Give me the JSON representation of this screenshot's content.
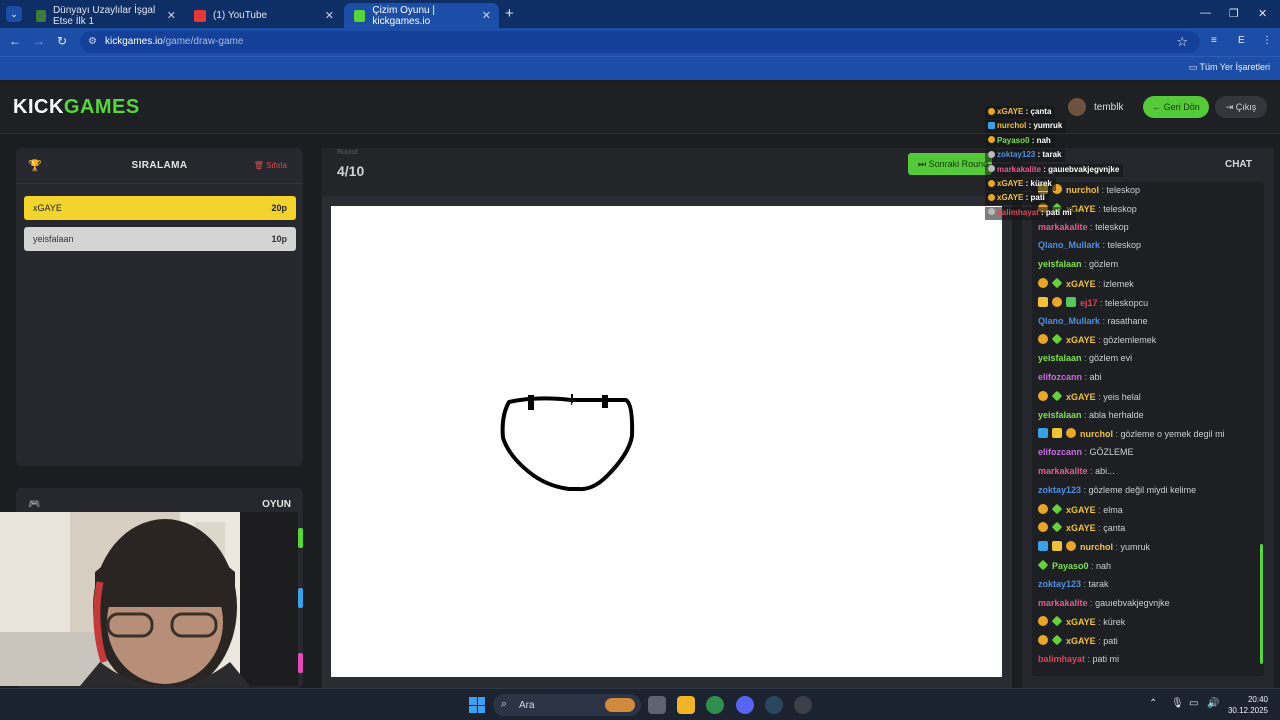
{
  "browser": {
    "tabs": [
      {
        "label": "Dünyayı Uzaylılar İşgal Etse İlk 1",
        "active": false
      },
      {
        "label": "(1) YouTube",
        "active": false
      },
      {
        "label": "Çizim Oyunu | kickgames.io",
        "active": true
      }
    ],
    "new_tab": "+",
    "url_domain": "kickgames.io",
    "url_path": "/game/draw-game",
    "profile_initial": "E",
    "bookmarks_all": "Tüm Yer İşaretleri"
  },
  "site": {
    "logo_kick": "KICK",
    "logo_games": "GAMES",
    "username": "temblk",
    "back_button": "Geri Dön",
    "exit_button": "Çıkış"
  },
  "ranking": {
    "title": "SIRALAMA",
    "reset_label": "Sıfırla",
    "players": [
      {
        "name": "xGAYE",
        "points": "20p"
      },
      {
        "name": "yeisfalaan",
        "points": "10p"
      }
    ]
  },
  "game_panel": {
    "title": "OYUN"
  },
  "round": {
    "label": "Round",
    "value": "4/10",
    "next_button": "Sonraki Round"
  },
  "chat": {
    "title": "CHAT",
    "messages": [
      {
        "user": "nurchol",
        "color": "#f0c23a",
        "text": "teleskop",
        "badges": [
          "crown",
          "gold"
        ]
      },
      {
        "user": "xGAYE",
        "color": "#f0c23a",
        "text": "teleskop",
        "badges": [
          "gold",
          "green"
        ]
      },
      {
        "user": "markakalite",
        "color": "#e45b8e",
        "text": "teleskop",
        "badges": []
      },
      {
        "user": "Qlano_Mullark",
        "color": "#4d8fe0",
        "text": "teleskop",
        "badges": []
      },
      {
        "user": "yeisfalaan",
        "color": "#7ee04a",
        "text": "gözlem",
        "badges": []
      },
      {
        "user": "xGAYE",
        "color": "#f0c23a",
        "text": "izlemek",
        "badges": [
          "gold",
          "green"
        ]
      },
      {
        "user": "ej17",
        "color": "#e0425a",
        "text": "teleskopcu",
        "badges": [
          "crown",
          "gold",
          "gift"
        ]
      },
      {
        "user": "Qlano_Mullark",
        "color": "#4d8fe0",
        "text": "rasathane",
        "badges": []
      },
      {
        "user": "xGAYE",
        "color": "#f0c23a",
        "text": "gözlemlemek",
        "badges": [
          "gold",
          "green"
        ]
      },
      {
        "user": "yeisfalaan",
        "color": "#7ee04a",
        "text": "gözlem evi",
        "badges": []
      },
      {
        "user": "elifozcann",
        "color": "#c86be0",
        "text": "abi",
        "badges": []
      },
      {
        "user": "xGAYE",
        "color": "#f0c23a",
        "text": "yeis helal",
        "badges": [
          "gold",
          "green"
        ]
      },
      {
        "user": "yeisfalaan",
        "color": "#7ee04a",
        "text": "abla herhalde",
        "badges": []
      },
      {
        "user": "nurchol",
        "color": "#f0c23a",
        "text": "gözleme o yemek degil mi",
        "badges": [
          "blue",
          "crown",
          "gold"
        ]
      },
      {
        "user": "elifozcann",
        "color": "#c86be0",
        "text": "GÖZLEME",
        "badges": []
      },
      {
        "user": "markakalite",
        "color": "#e45b8e",
        "text": "abi...",
        "badges": []
      },
      {
        "user": "zoktay123",
        "color": "#4d8fe0",
        "text": "gözleme değil miydi kelime",
        "badges": []
      },
      {
        "user": "xGAYE",
        "color": "#f0c23a",
        "text": "elma",
        "badges": [
          "gold",
          "green"
        ]
      },
      {
        "user": "xGAYE",
        "color": "#f0c23a",
        "text": "çanta",
        "badges": [
          "gold",
          "green"
        ]
      },
      {
        "user": "nurchol",
        "color": "#f0c23a",
        "text": "yumruk",
        "badges": [
          "blue",
          "crown",
          "gold"
        ]
      },
      {
        "user": "Payaso0",
        "color": "#7ee04a",
        "text": "nah",
        "badges": [
          "green"
        ]
      },
      {
        "user": "zoktay123",
        "color": "#4d8fe0",
        "text": "tarak",
        "badges": []
      },
      {
        "user": "markakalite",
        "color": "#e45b8e",
        "text": "gauıebvakjegvnjke",
        "badges": []
      },
      {
        "user": "xGAYE",
        "color": "#f0c23a",
        "text": "kürek",
        "badges": [
          "gold",
          "green"
        ]
      },
      {
        "user": "xGAYE",
        "color": "#f0c23a",
        "text": "pati",
        "badges": [
          "gold",
          "green"
        ]
      },
      {
        "user": "balimhayat",
        "color": "#e0425a",
        "text": "pati mi",
        "badges": []
      }
    ]
  },
  "stream_overlay": {
    "messages": [
      {
        "user": "xGAYE",
        "color": "#f0c23a",
        "text": "çanta"
      },
      {
        "user": "nurchol",
        "color": "#f0c23a",
        "text": "yumruk"
      },
      {
        "user": "Payaso0",
        "color": "#7ee04a",
        "text": "nah"
      },
      {
        "user": "zoktay123",
        "color": "#4d8fe0",
        "text": "tarak"
      },
      {
        "user": "markakalite",
        "color": "#e45b8e",
        "text": "gauıebvakjegvnjke"
      },
      {
        "user": "xGAYE",
        "color": "#f0c23a",
        "text": "kürek"
      },
      {
        "user": "xGAYE",
        "color": "#f0c23a",
        "text": "pati"
      },
      {
        "user": "balimhayat",
        "color": "#e0425a",
        "text": "pati mi"
      }
    ]
  },
  "taskbar": {
    "search_placeholder": "Ara",
    "time": "20:40",
    "date": "30.12.2025"
  },
  "colors": {
    "accent_green": "#57d63c",
    "first_place": "#f3d42c",
    "second_place": "#d4d4d4"
  }
}
